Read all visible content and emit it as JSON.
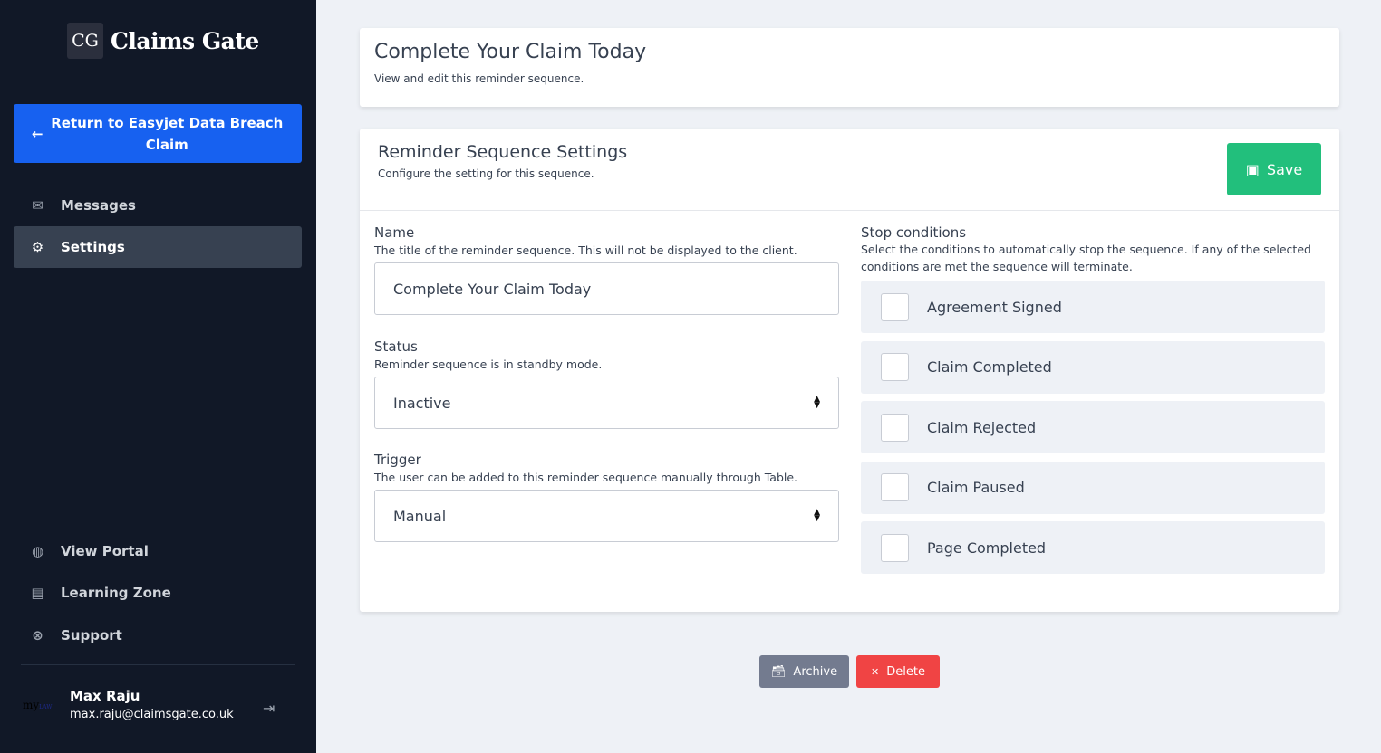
{
  "brand": {
    "mark": "CG",
    "name": "Claims Gate"
  },
  "sidebar": {
    "return_label": "Return to Easyjet Data Breach Claim",
    "items": [
      {
        "label": "Messages",
        "icon": "envelope-icon"
      },
      {
        "label": "Settings",
        "icon": "gear-icon",
        "active": true
      }
    ],
    "bottom_items": [
      {
        "label": "View Portal",
        "icon": "globe-icon"
      },
      {
        "label": "Learning Zone",
        "icon": "book-icon"
      },
      {
        "label": "Support",
        "icon": "life-ring-icon"
      }
    ],
    "user": {
      "logo": "my LAW",
      "name": "Max Raju",
      "email": "max.raju@claimsgate.co.uk"
    }
  },
  "header": {
    "title": "Complete Your Claim Today",
    "subtitle": "View and edit this reminder sequence."
  },
  "settings": {
    "title": "Reminder Sequence Settings",
    "subtitle": "Configure the setting for this sequence.",
    "save_label": "Save",
    "name": {
      "label": "Name",
      "hint": "The title of the reminder sequence. This will not be displayed to the client.",
      "value": "Complete Your Claim Today"
    },
    "status": {
      "label": "Status",
      "hint": "Reminder sequence is in standby mode.",
      "value": "Inactive"
    },
    "trigger": {
      "label": "Trigger",
      "hint": "The user can be added to this reminder sequence manually through Table.",
      "value": "Manual"
    },
    "stop": {
      "label": "Stop conditions",
      "hint": "Select the conditions to automatically stop the sequence. If any of the selected conditions are met the sequence will terminate.",
      "conditions": [
        {
          "label": "Agreement Signed",
          "checked": false
        },
        {
          "label": "Claim Completed",
          "checked": false
        },
        {
          "label": "Claim Rejected",
          "checked": false
        },
        {
          "label": "Claim Paused",
          "checked": false
        },
        {
          "label": "Page Completed",
          "checked": false
        }
      ]
    }
  },
  "actions": {
    "archive_label": "Archive",
    "delete_label": "Delete"
  },
  "colors": {
    "sidebar": "#111827",
    "primary": "#1761f0",
    "save": "#22bf7c",
    "archive": "#737b8f",
    "delete": "#f04444"
  }
}
